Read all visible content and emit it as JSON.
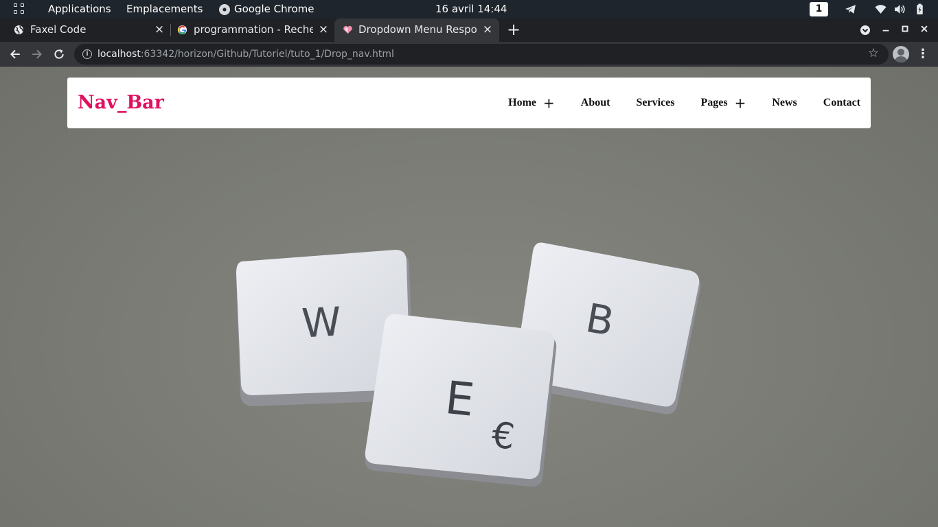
{
  "os_bar": {
    "applications": "Applications",
    "places": "Emplacements",
    "active_app": "Google Chrome",
    "clock": "16 avril  14:44",
    "workspace": "1"
  },
  "browser": {
    "tabs": [
      {
        "title": "Faxel Code",
        "icon": "globe-icon"
      },
      {
        "title": "programmation - Recherche",
        "icon": "google-icon"
      },
      {
        "title": "Dropdown Menu Responsive",
        "icon": "heart-icon",
        "active": true
      }
    ],
    "url_host": "localhost",
    "url_rest": ":63342/horizon/Github/Tutoriel/tuto_1/Drop_nav.html"
  },
  "page": {
    "brand": "Nav_Bar",
    "brand_color": "#e0105f",
    "menu": [
      {
        "label": "Home",
        "has_submenu": true
      },
      {
        "label": "About",
        "has_submenu": false
      },
      {
        "label": "Services",
        "has_submenu": false
      },
      {
        "label": "Pages",
        "has_submenu": true
      },
      {
        "label": "News",
        "has_submenu": false
      },
      {
        "label": "Contact",
        "has_submenu": false
      }
    ],
    "submenu_icon": "+",
    "hero_keys": {
      "w": "W",
      "e": "E",
      "b": "B",
      "euro": "€"
    }
  }
}
